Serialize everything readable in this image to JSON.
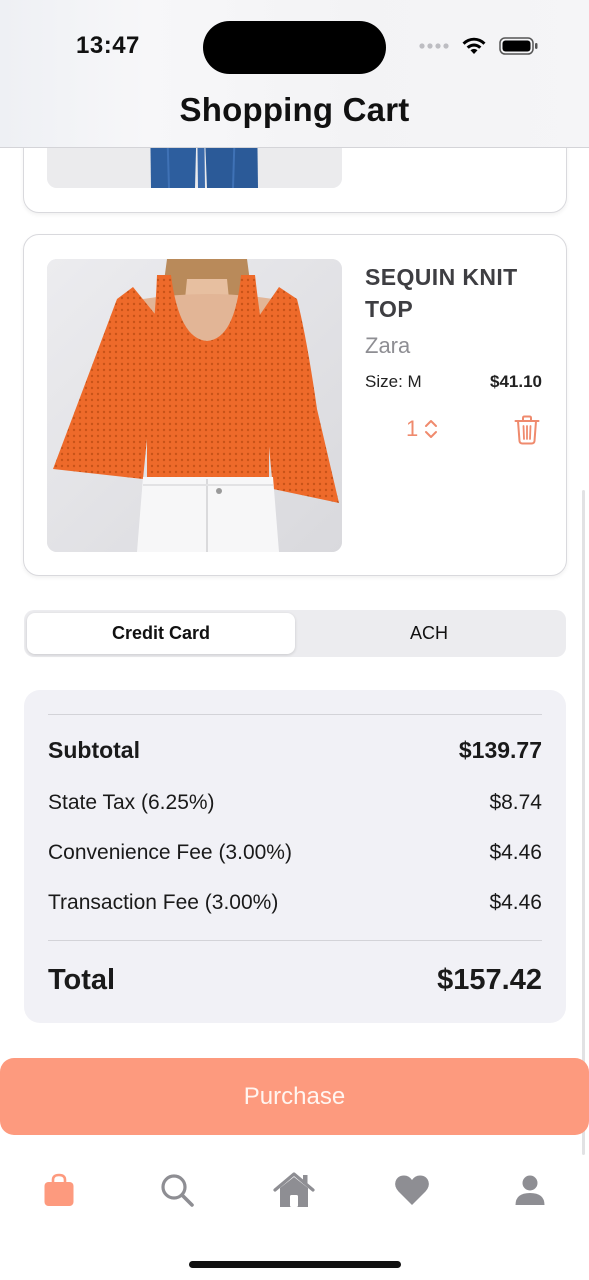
{
  "status_bar": {
    "time": "13:47"
  },
  "nav": {
    "title": "Shopping Cart"
  },
  "cart_item": {
    "name": "SEQUIN KNIT TOP",
    "brand": "Zara",
    "size": "Size: M",
    "price": "$41.10",
    "quantity": "1"
  },
  "payment_methods": {
    "options": [
      "Credit Card",
      "ACH"
    ],
    "selected": "Credit Card"
  },
  "summary": {
    "subtotal": {
      "label": "Subtotal",
      "value": "$139.77"
    },
    "state_tax": {
      "label": "State Tax (6.25%)",
      "value": "$8.74"
    },
    "convenience_fee": {
      "label": "Convenience Fee (3.00%)",
      "value": "$4.46"
    },
    "transaction_fee": {
      "label": "Transaction Fee (3.00%)",
      "value": "$4.46"
    },
    "total": {
      "label": "Total",
      "value": "$157.42"
    }
  },
  "purchase_button": {
    "label": "Purchase"
  },
  "tab_bar": {
    "items": [
      {
        "icon": "shopping-bag-icon",
        "active": true
      },
      {
        "icon": "search-icon",
        "active": false
      },
      {
        "icon": "home-icon",
        "active": false
      },
      {
        "icon": "heart-icon",
        "active": false
      },
      {
        "icon": "person-icon",
        "active": false
      }
    ]
  },
  "colors": {
    "accent": "#fd9a7e",
    "accent_icon": "#ef8a6d",
    "inactive_icon": "#8e8e93",
    "summary_bg": "#f1f1f6"
  }
}
